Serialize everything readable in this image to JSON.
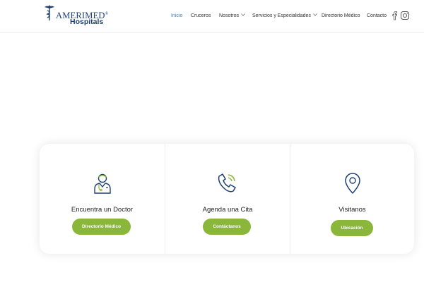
{
  "brand": {
    "name": "AMERIMED",
    "subtitle": "Hospitals",
    "registered": "®",
    "color": "#1d3f73"
  },
  "nav": {
    "items": [
      {
        "label": "Inicio",
        "active": true
      },
      {
        "label": "Cruceros",
        "active": false
      },
      {
        "label": "Nosotros",
        "active": false,
        "dropdown": true
      },
      {
        "label": "Servicios y Especialidades",
        "active": false,
        "dropdown": true
      },
      {
        "label": "Directorio Médico",
        "active": false
      },
      {
        "label": "Contacto",
        "active": false
      }
    ],
    "active_color": "#3a7fb8",
    "social": [
      "facebook-icon",
      "instagram-icon"
    ]
  },
  "cards": [
    {
      "icon": "doctor-icon",
      "title": "Encuentra un Doctor",
      "button": "Directorio Médico"
    },
    {
      "icon": "phone-call-icon",
      "title": "Agenda una Cita",
      "button": "Contáctanos"
    },
    {
      "icon": "location-pin-icon",
      "title": "Visitanos",
      "button": "Ubicación"
    }
  ],
  "colors": {
    "button": "#8ab63a",
    "icon_navy": "#1d3f73",
    "icon_green": "#8ab63a"
  }
}
